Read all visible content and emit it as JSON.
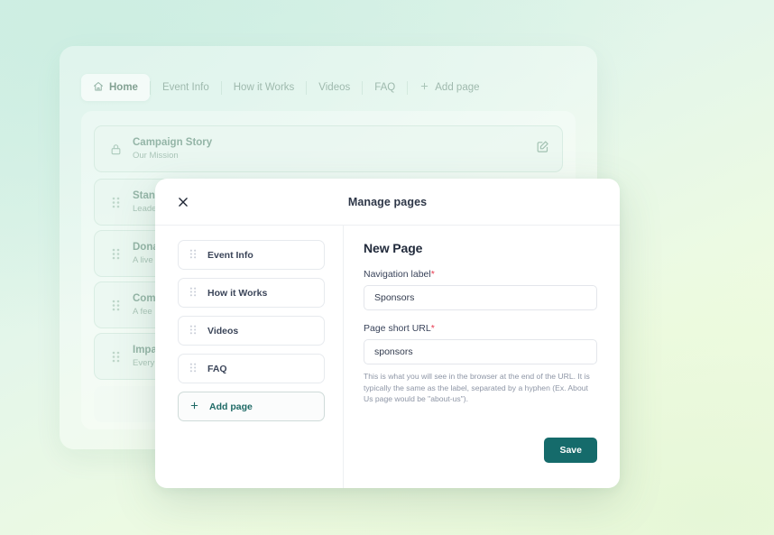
{
  "background_app": {
    "tabs": [
      {
        "label": "Home",
        "icon": "home-icon",
        "active": true
      },
      {
        "label": "Event Info",
        "active": false
      },
      {
        "label": "How it Works",
        "active": false
      },
      {
        "label": "Videos",
        "active": false
      },
      {
        "label": "FAQ",
        "active": false
      },
      {
        "label": "Add page",
        "icon": "plus-icon",
        "active": false
      }
    ],
    "content_cards": [
      {
        "title": "Campaign Story",
        "subtitle": "Our Mission",
        "lead_icon": "lock-icon",
        "action_icon": "edit-icon"
      },
      {
        "title": "Stand",
        "subtitle": "Leade",
        "lead_icon": "drag-handle-icon"
      },
      {
        "title": "Dona",
        "subtitle": "A live",
        "lead_icon": "drag-handle-icon"
      },
      {
        "title": "Com",
        "subtitle": "A fee",
        "lead_icon": "drag-handle-icon"
      },
      {
        "title": "Impa",
        "subtitle": "Every",
        "lead_icon": "drag-handle-icon"
      }
    ]
  },
  "modal": {
    "title": "Manage pages",
    "close_icon": "close-icon",
    "pages": [
      {
        "label": "Event Info",
        "icon": "drag-handle-icon"
      },
      {
        "label": "How it Works",
        "icon": "drag-handle-icon"
      },
      {
        "label": "Videos",
        "icon": "drag-handle-icon"
      },
      {
        "label": "FAQ",
        "icon": "drag-handle-icon"
      }
    ],
    "add_page": {
      "label": "Add page",
      "icon": "plus-icon"
    },
    "form": {
      "heading": "New Page",
      "nav_label": "Navigation label",
      "nav_required": "*",
      "nav_value": "Sponsors",
      "nav_placeholder": "Navigation label",
      "url_label": "Page short URL",
      "url_required": "*",
      "url_value": "sponsors",
      "url_placeholder": "Page short URL",
      "helper": "This is what you will see in the browser at the end of the URL. It is typically the same as the label, separated by a hyphen (Ex. About Us page would be \"about-us\")."
    },
    "save_label": "Save"
  },
  "colors": {
    "accent_teal": "#156b6b",
    "required_red": "#e8384f",
    "bg_mint": "#d4f0e6",
    "bg_lime": "#eefbe1"
  }
}
